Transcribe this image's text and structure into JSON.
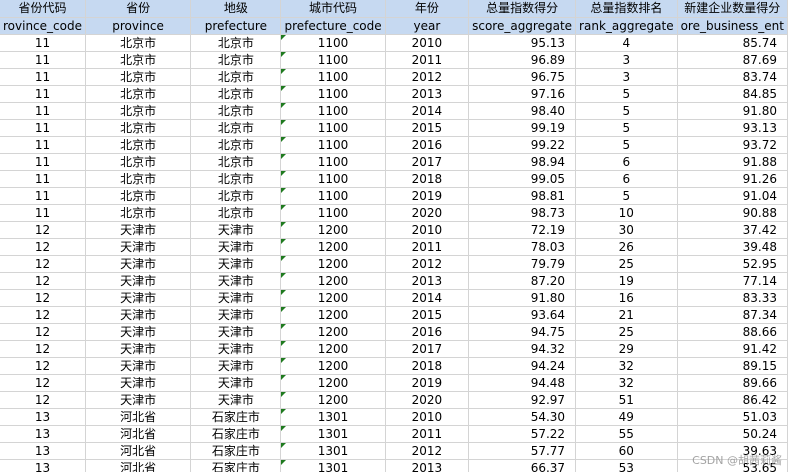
{
  "headers": {
    "top": [
      "省份代码",
      "省份",
      "地级",
      "城市代码",
      "年份",
      "总量指数得分",
      "总量指数排名",
      "新建企业数量得分"
    ],
    "sub": [
      "rovince_code",
      "province",
      "prefecture",
      "prefecture_code",
      "year",
      "score_aggregate",
      "rank_aggregate",
      "ore_business_ent"
    ]
  },
  "rows": [
    [
      "11",
      "北京市",
      "北京市",
      "1100",
      "2010",
      "95.13",
      "4",
      "85.74"
    ],
    [
      "11",
      "北京市",
      "北京市",
      "1100",
      "2011",
      "96.89",
      "3",
      "87.69"
    ],
    [
      "11",
      "北京市",
      "北京市",
      "1100",
      "2012",
      "96.75",
      "3",
      "83.74"
    ],
    [
      "11",
      "北京市",
      "北京市",
      "1100",
      "2013",
      "97.16",
      "5",
      "84.85"
    ],
    [
      "11",
      "北京市",
      "北京市",
      "1100",
      "2014",
      "98.40",
      "5",
      "91.80"
    ],
    [
      "11",
      "北京市",
      "北京市",
      "1100",
      "2015",
      "99.19",
      "5",
      "93.13"
    ],
    [
      "11",
      "北京市",
      "北京市",
      "1100",
      "2016",
      "99.22",
      "5",
      "93.72"
    ],
    [
      "11",
      "北京市",
      "北京市",
      "1100",
      "2017",
      "98.94",
      "6",
      "91.88"
    ],
    [
      "11",
      "北京市",
      "北京市",
      "1100",
      "2018",
      "99.05",
      "6",
      "91.26"
    ],
    [
      "11",
      "北京市",
      "北京市",
      "1100",
      "2019",
      "98.81",
      "5",
      "91.04"
    ],
    [
      "11",
      "北京市",
      "北京市",
      "1100",
      "2020",
      "98.73",
      "10",
      "90.88"
    ],
    [
      "12",
      "天津市",
      "天津市",
      "1200",
      "2010",
      "72.19",
      "30",
      "37.42"
    ],
    [
      "12",
      "天津市",
      "天津市",
      "1200",
      "2011",
      "78.03",
      "26",
      "39.48"
    ],
    [
      "12",
      "天津市",
      "天津市",
      "1200",
      "2012",
      "79.79",
      "25",
      "52.95"
    ],
    [
      "12",
      "天津市",
      "天津市",
      "1200",
      "2013",
      "87.20",
      "19",
      "77.14"
    ],
    [
      "12",
      "天津市",
      "天津市",
      "1200",
      "2014",
      "91.80",
      "16",
      "83.33"
    ],
    [
      "12",
      "天津市",
      "天津市",
      "1200",
      "2015",
      "93.64",
      "21",
      "87.34"
    ],
    [
      "12",
      "天津市",
      "天津市",
      "1200",
      "2016",
      "94.75",
      "25",
      "88.66"
    ],
    [
      "12",
      "天津市",
      "天津市",
      "1200",
      "2017",
      "94.32",
      "29",
      "91.42"
    ],
    [
      "12",
      "天津市",
      "天津市",
      "1200",
      "2018",
      "94.24",
      "32",
      "89.15"
    ],
    [
      "12",
      "天津市",
      "天津市",
      "1200",
      "2019",
      "94.48",
      "32",
      "89.66"
    ],
    [
      "12",
      "天津市",
      "天津市",
      "1200",
      "2020",
      "92.97",
      "51",
      "86.42"
    ],
    [
      "13",
      "河北省",
      "石家庄市",
      "1301",
      "2010",
      "54.30",
      "49",
      "51.03"
    ],
    [
      "13",
      "河北省",
      "石家庄市",
      "1301",
      "2011",
      "57.22",
      "55",
      "50.24"
    ],
    [
      "13",
      "河北省",
      "石家庄市",
      "1301",
      "2012",
      "57.77",
      "60",
      "39.63"
    ],
    [
      "13",
      "河北省",
      "石家庄市",
      "1301",
      "2013",
      "66.37",
      "53",
      "53.65"
    ]
  ],
  "watermark": "CSDN @胡茜莉酱"
}
